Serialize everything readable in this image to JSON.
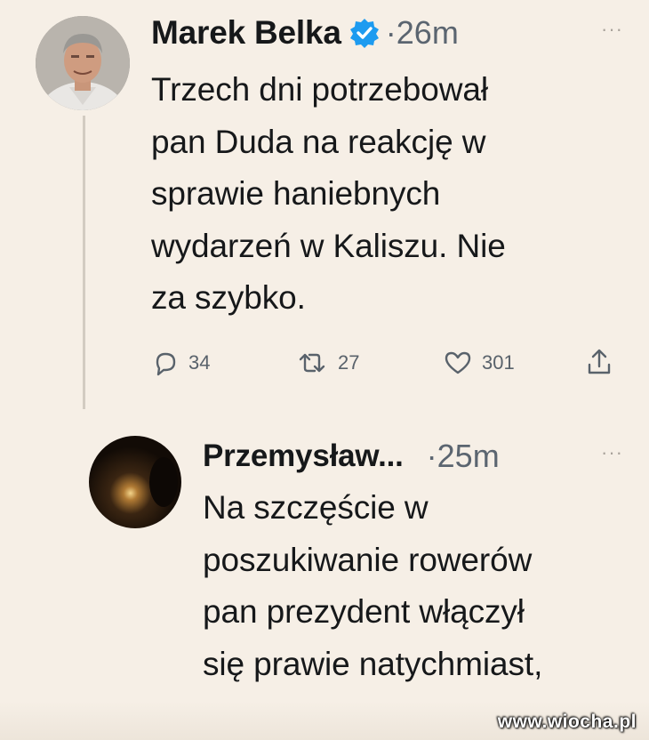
{
  "tweet1": {
    "author": "Marek Belka",
    "time": "·26m",
    "more": "···",
    "text": "Trzech dni potrzebował\npan Duda na reakcję w\nsprawie haniebnych\nwydarzeń w Kaliszu. Nie\nza szybko.",
    "replies": "34",
    "retweets": "27",
    "likes": "301",
    "icons": [
      "reply-icon",
      "retweet-icon",
      "like-icon",
      "share-icon",
      "verified-badge-icon"
    ]
  },
  "tweet2": {
    "author": "Przemysław...",
    "time": "·25m",
    "more": "···",
    "text": "Na szczęście w\nposzukiwanie rowerów\npan prezydent włączył\nsię prawie natychmiast,"
  },
  "watermark": "www.wiocha.pl",
  "colors": {
    "background": "#f6efe6",
    "text": "#16181a",
    "muted": "#5b6570",
    "verified": "#1d9bf0"
  }
}
